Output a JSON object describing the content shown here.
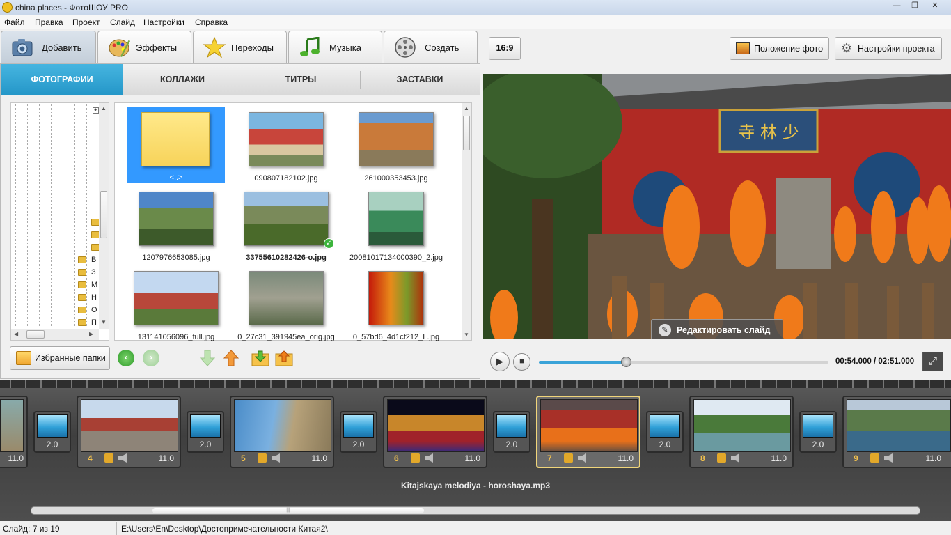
{
  "window": {
    "title": "china places - ФотоШОУ PRO"
  },
  "menu": [
    "Файл",
    "Правка",
    "Проект",
    "Слайд",
    "Настройки",
    "Справка"
  ],
  "main_tabs": [
    "Добавить",
    "Эффекты",
    "Переходы",
    "Музыка",
    "Создать"
  ],
  "sub_tabs": [
    "ФОТОГРАФИИ",
    "КОЛЛАЖИ",
    "ТИТРЫ",
    "ЗАСТАВКИ"
  ],
  "tree": {
    "folder_labels": [
      "В",
      "З",
      "М",
      "Н",
      "О",
      "П"
    ]
  },
  "files": [
    {
      "name": "<..>",
      "selected": true
    },
    {
      "name": "090807182102.jpg"
    },
    {
      "name": "261000353453.jpg"
    },
    {
      "name": "1207976653085.jpg"
    },
    {
      "name": "33755610282426-o.jpg",
      "bold": true,
      "checked": true
    },
    {
      "name": "20081017134000390_2.jpg"
    },
    {
      "name": "131141056096_full.jpg"
    },
    {
      "name": "0_27c31_391945ea_orig.jpg"
    },
    {
      "name": "0_57bd6_4d1cf212_L.jpg"
    }
  ],
  "bottom_left": {
    "favorites_label": "Избранные папки"
  },
  "right_toolbar": {
    "aspect": "16:9",
    "photo_position": "Положение фото",
    "project_settings": "Настройки проекта"
  },
  "preview": {
    "edit_slide": "Редактировать слайд",
    "sign_text": "寺 林 少"
  },
  "player": {
    "time": "00:54.000 / 02:51.000",
    "progress": 0.3
  },
  "timeline": {
    "partial_left_duration": "11.0",
    "transitions": [
      "2.0",
      "2.0",
      "2.0",
      "2.0",
      "2.0",
      "2.0"
    ],
    "slides": [
      {
        "num": "4",
        "duration": "11.0"
      },
      {
        "num": "5",
        "duration": "11.0"
      },
      {
        "num": "6",
        "duration": "11.0"
      },
      {
        "num": "7",
        "duration": "11.0",
        "selected": true
      },
      {
        "num": "8",
        "duration": "11.0"
      },
      {
        "num": "9",
        "duration": "11.0"
      }
    ],
    "music_track": "Kitajskaya melodiya - horoshaya.mp3"
  },
  "status": {
    "slide": "Слайд: 7 из 19",
    "path": "E:\\Users\\En\\Desktop\\Достопримечательности Китая2\\"
  }
}
